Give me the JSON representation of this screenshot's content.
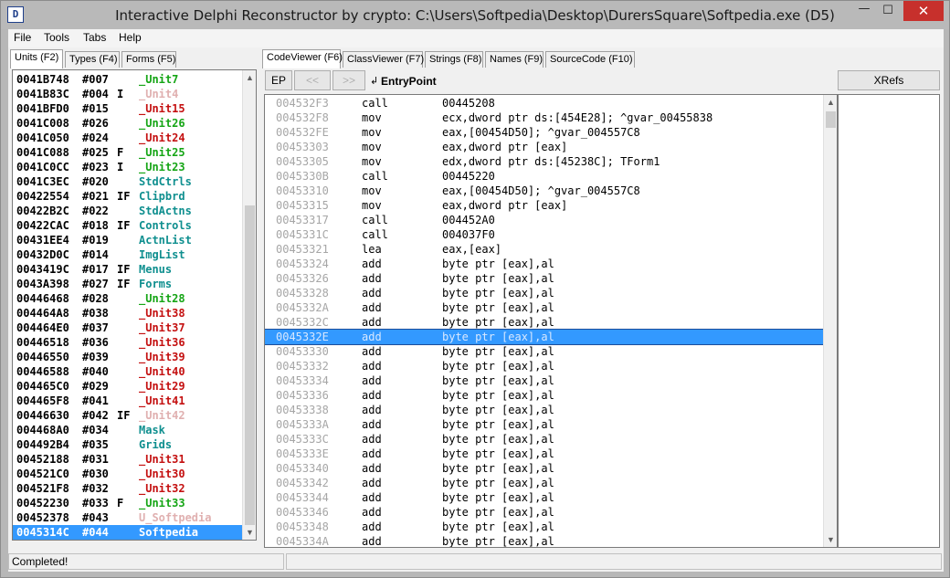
{
  "window": {
    "title": "Interactive Delphi Reconstructor by crypto: C:\\Users\\Softpedia\\Desktop\\DurersSquare\\Softpedia.exe (D5)",
    "app_icon": "delphi-app-icon",
    "controls": {
      "minimize": "—",
      "maximize": "☐",
      "close": "✕"
    }
  },
  "menu": {
    "items": [
      "File",
      "Tools",
      "Tabs",
      "Help"
    ]
  },
  "left_tabs": [
    {
      "label": "Units (F2)",
      "active": true
    },
    {
      "label": "Types (F4)",
      "active": false
    },
    {
      "label": "Forms (F5)",
      "active": false
    }
  ],
  "right_tabs": [
    {
      "label": "CodeViewer (F6)",
      "active": true
    },
    {
      "label": "ClassViewer (F7)",
      "active": false
    },
    {
      "label": "Strings (F8)",
      "active": false
    },
    {
      "label": "Names (F9)",
      "active": false
    },
    {
      "label": "SourceCode (F10)",
      "active": false
    }
  ],
  "toolbar": {
    "ep_label": "EP",
    "back_label": "<<",
    "forward_label": ">>",
    "entry_label": "EntryPoint",
    "entry_icon": "arrow-enter-icon",
    "xrefs_label": "XRefs"
  },
  "units": [
    {
      "addr": "0041B748",
      "num": "#007",
      "flag": "",
      "name": "_Unit7",
      "color": "green"
    },
    {
      "addr": "0041B83C",
      "num": "#004",
      "flag": "I",
      "name": "_Unit4",
      "color": "pink"
    },
    {
      "addr": "0041BFD0",
      "num": "#015",
      "flag": "",
      "name": "_Unit15",
      "color": "red"
    },
    {
      "addr": "0041C008",
      "num": "#026",
      "flag": "",
      "name": "_Unit26",
      "color": "green"
    },
    {
      "addr": "0041C050",
      "num": "#024",
      "flag": "",
      "name": "_Unit24",
      "color": "red"
    },
    {
      "addr": "0041C088",
      "num": "#025",
      "flag": "F",
      "name": "_Unit25",
      "color": "green"
    },
    {
      "addr": "0041C0CC",
      "num": "#023",
      "flag": "I",
      "name": "_Unit23",
      "color": "green"
    },
    {
      "addr": "0041C3EC",
      "num": "#020",
      "flag": "",
      "name": "StdCtrls",
      "color": "teal"
    },
    {
      "addr": "00422554",
      "num": "#021",
      "flag": "IF",
      "name": "Clipbrd",
      "color": "teal"
    },
    {
      "addr": "00422B2C",
      "num": "#022",
      "flag": "",
      "name": "StdActns",
      "color": "teal"
    },
    {
      "addr": "00422CAC",
      "num": "#018",
      "flag": "IF",
      "name": "Controls",
      "color": "teal"
    },
    {
      "addr": "00431EE4",
      "num": "#019",
      "flag": "",
      "name": "ActnList",
      "color": "teal"
    },
    {
      "addr": "00432D0C",
      "num": "#014",
      "flag": "",
      "name": "ImgList",
      "color": "teal"
    },
    {
      "addr": "0043419C",
      "num": "#017",
      "flag": "IF",
      "name": "Menus",
      "color": "teal"
    },
    {
      "addr": "0043A398",
      "num": "#027",
      "flag": "IF",
      "name": "Forms",
      "color": "teal"
    },
    {
      "addr": "00446468",
      "num": "#028",
      "flag": "",
      "name": "_Unit28",
      "color": "green"
    },
    {
      "addr": "004464A8",
      "num": "#038",
      "flag": "",
      "name": "_Unit38",
      "color": "red"
    },
    {
      "addr": "004464E0",
      "num": "#037",
      "flag": "",
      "name": "_Unit37",
      "color": "red"
    },
    {
      "addr": "00446518",
      "num": "#036",
      "flag": "",
      "name": "_Unit36",
      "color": "red"
    },
    {
      "addr": "00446550",
      "num": "#039",
      "flag": "",
      "name": "_Unit39",
      "color": "red"
    },
    {
      "addr": "00446588",
      "num": "#040",
      "flag": "",
      "name": "_Unit40",
      "color": "red"
    },
    {
      "addr": "004465C0",
      "num": "#029",
      "flag": "",
      "name": "_Unit29",
      "color": "red"
    },
    {
      "addr": "004465F8",
      "num": "#041",
      "flag": "",
      "name": "_Unit41",
      "color": "red"
    },
    {
      "addr": "00446630",
      "num": "#042",
      "flag": "IF",
      "name": "_Unit42",
      "color": "pink"
    },
    {
      "addr": "004468A0",
      "num": "#034",
      "flag": "",
      "name": "Mask",
      "color": "teal"
    },
    {
      "addr": "004492B4",
      "num": "#035",
      "flag": "",
      "name": "Grids",
      "color": "teal"
    },
    {
      "addr": "00452188",
      "num": "#031",
      "flag": "",
      "name": "_Unit31",
      "color": "red"
    },
    {
      "addr": "004521C0",
      "num": "#030",
      "flag": "",
      "name": "_Unit30",
      "color": "red"
    },
    {
      "addr": "004521F8",
      "num": "#032",
      "flag": "",
      "name": "_Unit32",
      "color": "red"
    },
    {
      "addr": "00452230",
      "num": "#033",
      "flag": "F",
      "name": "_Unit33",
      "color": "green"
    },
    {
      "addr": "00452378",
      "num": "#043",
      "flag": "",
      "name": "U_Softpedia",
      "color": "pink"
    },
    {
      "addr": "0045314C",
      "num": "#044",
      "flag": "",
      "name": "Softpedia",
      "color": "white",
      "selected": true
    }
  ],
  "code": [
    {
      "addr": "004532F3",
      "mnem": "call",
      "ops": "00445208"
    },
    {
      "addr": "004532F8",
      "mnem": "mov",
      "ops": "ecx,dword ptr ds:[454E28]; ^gvar_00455838"
    },
    {
      "addr": "004532FE",
      "mnem": "mov",
      "ops": "eax,[00454D50]; ^gvar_004557C8"
    },
    {
      "addr": "00453303",
      "mnem": "mov",
      "ops": "eax,dword ptr [eax]"
    },
    {
      "addr": "00453305",
      "mnem": "mov",
      "ops": "edx,dword ptr ds:[45238C]; TForm1"
    },
    {
      "addr": "0045330B",
      "mnem": "call",
      "ops": "00445220"
    },
    {
      "addr": "00453310",
      "mnem": "mov",
      "ops": "eax,[00454D50]; ^gvar_004557C8"
    },
    {
      "addr": "00453315",
      "mnem": "mov",
      "ops": "eax,dword ptr [eax]"
    },
    {
      "addr": "00453317",
      "mnem": "call",
      "ops": "004452A0"
    },
    {
      "addr": "0045331C",
      "mnem": "call",
      "ops": "004037F0"
    },
    {
      "addr": "00453321",
      "mnem": "lea",
      "ops": "eax,[eax]"
    },
    {
      "addr": "00453324",
      "mnem": "add",
      "ops": "byte ptr [eax],al"
    },
    {
      "addr": "00453326",
      "mnem": "add",
      "ops": "byte ptr [eax],al"
    },
    {
      "addr": "00453328",
      "mnem": "add",
      "ops": "byte ptr [eax],al"
    },
    {
      "addr": "0045332A",
      "mnem": "add",
      "ops": "byte ptr [eax],al"
    },
    {
      "addr": "0045332C",
      "mnem": "add",
      "ops": "byte ptr [eax],al"
    },
    {
      "addr": "0045332E",
      "mnem": "add",
      "ops": "byte ptr [eax],al",
      "selected": true
    },
    {
      "addr": "00453330",
      "mnem": "add",
      "ops": "byte ptr [eax],al"
    },
    {
      "addr": "00453332",
      "mnem": "add",
      "ops": "byte ptr [eax],al"
    },
    {
      "addr": "00453334",
      "mnem": "add",
      "ops": "byte ptr [eax],al"
    },
    {
      "addr": "00453336",
      "mnem": "add",
      "ops": "byte ptr [eax],al"
    },
    {
      "addr": "00453338",
      "mnem": "add",
      "ops": "byte ptr [eax],al"
    },
    {
      "addr": "0045333A",
      "mnem": "add",
      "ops": "byte ptr [eax],al"
    },
    {
      "addr": "0045333C",
      "mnem": "add",
      "ops": "byte ptr [eax],al"
    },
    {
      "addr": "0045333E",
      "mnem": "add",
      "ops": "byte ptr [eax],al"
    },
    {
      "addr": "00453340",
      "mnem": "add",
      "ops": "byte ptr [eax],al"
    },
    {
      "addr": "00453342",
      "mnem": "add",
      "ops": "byte ptr [eax],al"
    },
    {
      "addr": "00453344",
      "mnem": "add",
      "ops": "byte ptr [eax],al"
    },
    {
      "addr": "00453346",
      "mnem": "add",
      "ops": "byte ptr [eax],al"
    },
    {
      "addr": "00453348",
      "mnem": "add",
      "ops": "byte ptr [eax],al"
    },
    {
      "addr": "0045334A",
      "mnem": "add",
      "ops": "byte ptr [eax],al"
    }
  ],
  "status": {
    "text": "Completed!"
  },
  "colors": {
    "selection": "#3399ff",
    "unit_green": "#15a515",
    "unit_red": "#c41010",
    "unit_teal": "#0f8f8f",
    "unit_pink": "#e0b0b0",
    "address_gray": "#a6a6a6",
    "close_button": "#c7302c"
  }
}
